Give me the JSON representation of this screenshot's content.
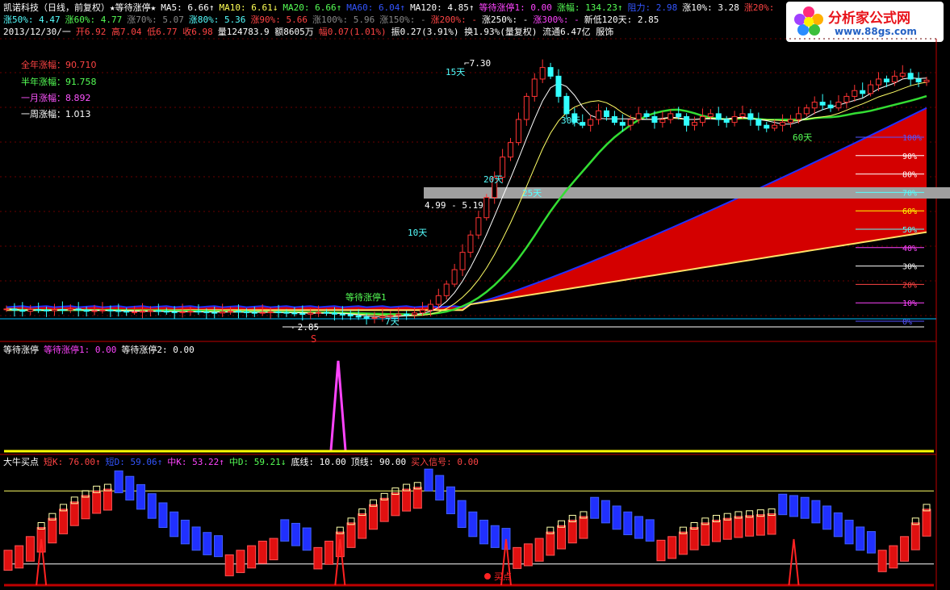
{
  "header": {
    "line1": [
      {
        "text": "凯诺科技（日线，前复权）★等待涨停★",
        "color": "#ffffff"
      },
      {
        "text": "MA5: 6.66↑",
        "color": "#ffffff"
      },
      {
        "text": "MA10: 6.61↓",
        "color": "#ffff55"
      },
      {
        "text": "MA20: 6.66↑",
        "color": "#55ff55"
      },
      {
        "text": "MA60: 6.04↑",
        "color": "#3355ff"
      },
      {
        "text": "MA120: 4.85↑",
        "color": "#ffffff"
      },
      {
        "text": "等待涨停1: 0.00",
        "color": "#ff44ff"
      },
      {
        "text": "涨幅: 134.23↑",
        "color": "#55ff55"
      },
      {
        "text": "阻力: 2.98",
        "color": "#3355ff"
      },
      {
        "text": "涨10%: 3.28",
        "color": "#ffffff"
      },
      {
        "text": "涨20%:",
        "color": "#ff4444"
      }
    ],
    "line2": [
      {
        "text": "涨50%: 4.47",
        "color": "#55ffff"
      },
      {
        "text": "涨60%: 4.77",
        "color": "#55ff55"
      },
      {
        "text": "涨70%: 5.07",
        "color": "#888888"
      },
      {
        "text": "涨80%: 5.36",
        "color": "#55ffff"
      },
      {
        "text": "涨90%: 5.66",
        "color": "#ff4444"
      },
      {
        "text": "涨100%: 5.96",
        "color": "#888888"
      },
      {
        "text": "涨150%: -",
        "color": "#888888"
      },
      {
        "text": "涨200%: -",
        "color": "#ff4444"
      },
      {
        "text": "涨250%: -",
        "color": "#ffffff"
      },
      {
        "text": "涨300%: -",
        "color": "#ff44ff"
      },
      {
        "text": "新低120天: 2.85",
        "color": "#ffffff"
      }
    ],
    "line3": [
      {
        "text": "2013/12/30/一",
        "color": "#ffffff"
      },
      {
        "text": "开6.92 高7.04 低6.77 收6.98",
        "color": "#ff4444"
      },
      {
        "text": "量124783.9 额8605万",
        "color": "#ffffff"
      },
      {
        "text": "幅0.07(1.01%)",
        "color": "#ff4444"
      },
      {
        "text": "振0.27(3.91%) 换1.93%(量复权) 流通6.47亿 服饰",
        "color": "#ffffff"
      }
    ]
  },
  "logo": {
    "title": "分析家公式网",
    "url": "www.88gs.com"
  },
  "legend": [
    {
      "text": "全年涨幅：90.710",
      "color": "#ff4444"
    },
    {
      "text": "半年涨幅：91.758",
      "color": "#55ff55"
    },
    {
      "text": "一月涨幅：8.892",
      "color": "#ff55ff"
    },
    {
      "text": "一周涨幅：1.013",
      "color": "#ffffff"
    }
  ],
  "price_annotations": {
    "high": "7.30",
    "low": "2.85",
    "range_label": "4.99 - 5.19",
    "days": [
      "15天",
      "30天",
      "20天",
      "25天",
      "10天",
      "60天",
      "7天"
    ],
    "signal": "等待涨停1",
    "marker": "S"
  },
  "right_scale": [
    "100%",
    "90%",
    "80%",
    "70%",
    "60%",
    "50%",
    "40%",
    "30%",
    "20%",
    "10%",
    "0%"
  ],
  "panel2": {
    "title": "等待涨停",
    "items": [
      {
        "text": "等待涨停1: 0.00",
        "color": "#ff44ff"
      },
      {
        "text": "等待涨停2: 0.00",
        "color": "#ffffff"
      }
    ]
  },
  "panel3": {
    "title": "大牛买点",
    "items": [
      {
        "text": "短K: 76.00↑",
        "color": "#ff4444"
      },
      {
        "text": "短D: 59.06↑",
        "color": "#3355ff"
      },
      {
        "text": "中K: 53.22↑",
        "color": "#ff44ff"
      },
      {
        "text": "中D: 59.21↓",
        "color": "#55ff55"
      },
      {
        "text": "底线: 10.00",
        "color": "#ffffff"
      },
      {
        "text": "顶线: 90.00",
        "color": "#ffffff"
      },
      {
        "text": "买入信号: 0.00",
        "color": "#ff4444"
      }
    ],
    "buy_label": "买点"
  },
  "chart_data": [
    {
      "type": "candlestick",
      "title": "凯诺科技（日线，前复权）",
      "y_range": [
        2.5,
        7.6
      ],
      "close": [
        3.02,
        3.0,
        2.98,
        3.01,
        3.0,
        2.99,
        3.01,
        3.0,
        3.02,
        3.0,
        2.98,
        2.99,
        3.0,
        2.99,
        2.98,
        2.97,
        2.97,
        2.98,
        2.99,
        2.98,
        2.97,
        2.96,
        2.97,
        2.98,
        2.97,
        2.96,
        2.95,
        2.97,
        2.98,
        2.97,
        2.96,
        2.95,
        2.96,
        2.97,
        2.96,
        2.95,
        2.94,
        2.93,
        2.95,
        2.96,
        2.95,
        2.93,
        2.92,
        2.9,
        2.88,
        2.86,
        2.87,
        2.89,
        2.91,
        2.93,
        2.92,
        2.95,
        3.0,
        3.1,
        3.25,
        3.45,
        3.7,
        4.0,
        4.3,
        4.6,
        4.95,
        5.3,
        5.65,
        5.9,
        6.3,
        6.7,
        7.0,
        7.2,
        7.05,
        6.7,
        6.4,
        6.25,
        6.2,
        6.3,
        6.45,
        6.35,
        6.25,
        6.2,
        6.3,
        6.4,
        6.35,
        6.25,
        6.3,
        6.4,
        6.35,
        6.2,
        6.25,
        6.35,
        6.4,
        6.3,
        6.25,
        6.35,
        6.4,
        6.3,
        6.2,
        6.15,
        6.2,
        6.25,
        6.3,
        6.4,
        6.5,
        6.6,
        6.55,
        6.5,
        6.6,
        6.7,
        6.8,
        6.75,
        6.9,
        7.0,
        6.95,
        7.05,
        7.1,
        7.0,
        6.95,
        6.98
      ]
    },
    {
      "type": "line",
      "title": "等待涨停",
      "y_range": [
        0,
        1
      ],
      "series": [
        {
          "name": "等待涨停1",
          "x_index": 52,
          "value": 1
        }
      ]
    },
    {
      "type": "bar",
      "title": "大牛买点",
      "y_range": [
        0,
        100
      ],
      "series": [
        {
          "name": "短K",
          "values": [
            25,
            30,
            40,
            50,
            60,
            70,
            78,
            85,
            90,
            92,
            88,
            80,
            70,
            60,
            50,
            40,
            32,
            25,
            20,
            18,
            20,
            25,
            30,
            35,
            38,
            35,
            30,
            25,
            28,
            35,
            45,
            55,
            65,
            75,
            82,
            88,
            92,
            94,
            90,
            80,
            65,
            50,
            40,
            32,
            28,
            26,
            28,
            32,
            38,
            45,
            52,
            58,
            62,
            60,
            55,
            48,
            42,
            38,
            35,
            36,
            40,
            45,
            50,
            55,
            58,
            60,
            62,
            63,
            64,
            65,
            64,
            62,
            60,
            55,
            48,
            40,
            32,
            25,
            22,
            25,
            30,
            40,
            55,
            70
          ]
        },
        {
          "name": "底线",
          "value": 10
        },
        {
          "name": "顶线",
          "value": 90
        }
      ],
      "buy_signals": [
        3,
        30,
        45,
        71
      ]
    }
  ]
}
